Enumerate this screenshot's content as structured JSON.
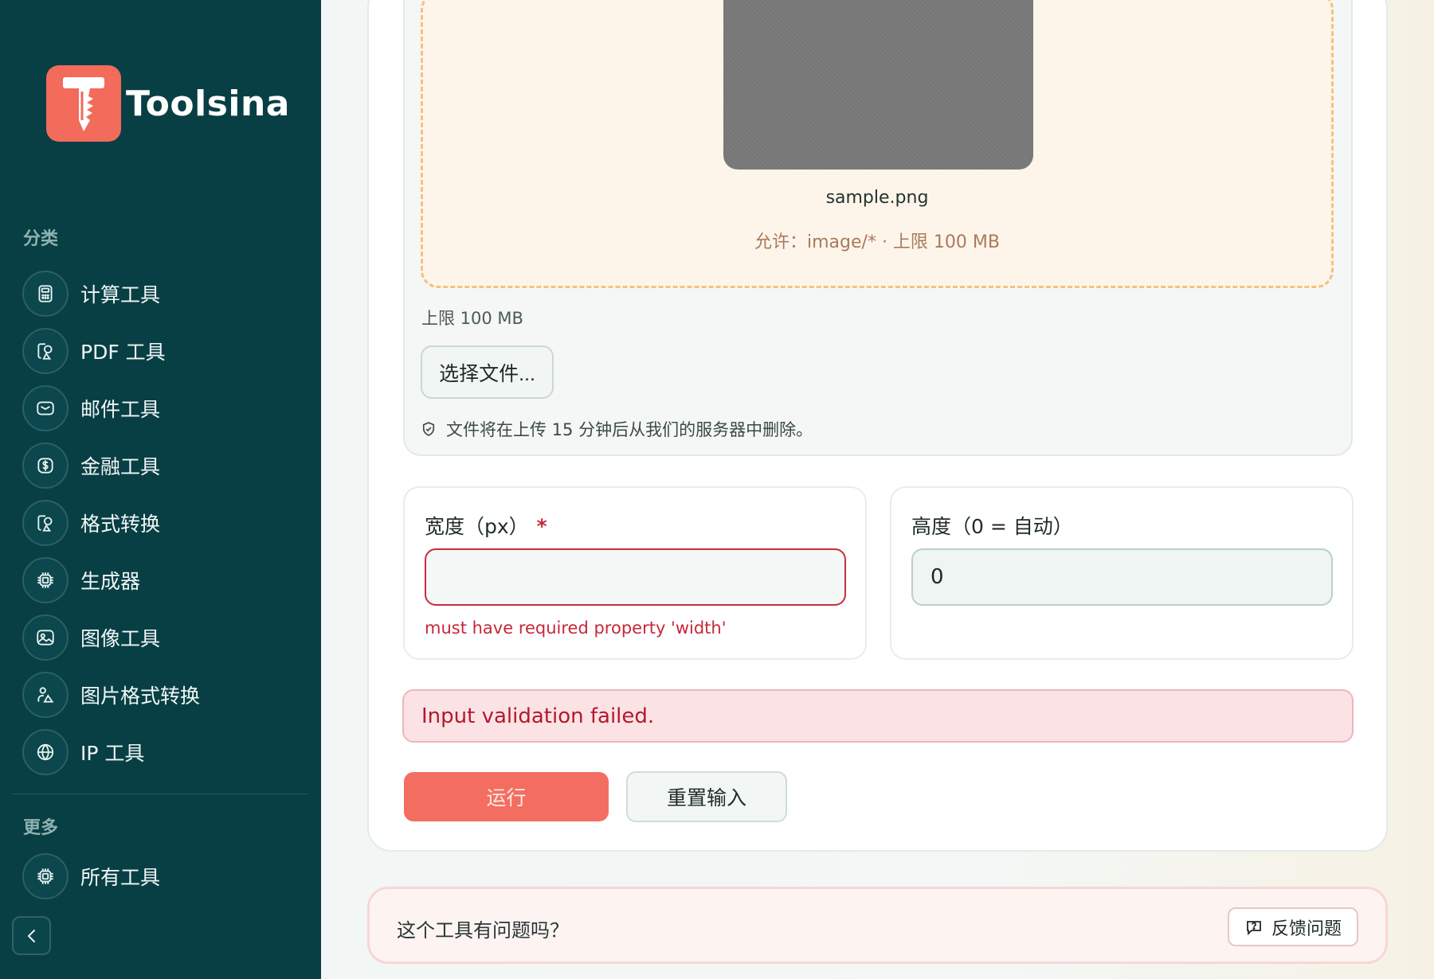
{
  "brand": {
    "name": "Toolsina",
    "logo_icon": "screw-logo-icon",
    "logo_color": "#f26b5b"
  },
  "sidebar": {
    "categories_label": "分类",
    "items": [
      {
        "label": "计算工具",
        "icon": "calculator-icon"
      },
      {
        "label": "PDF 工具",
        "icon": "document-shapes-icon"
      },
      {
        "label": "邮件工具",
        "icon": "mail-icon"
      },
      {
        "label": "金融工具",
        "icon": "dollar-icon"
      },
      {
        "label": "格式转换",
        "icon": "document-shapes-icon"
      },
      {
        "label": "生成器",
        "icon": "chip-icon"
      },
      {
        "label": "图像工具",
        "icon": "image-icon"
      },
      {
        "label": "图片格式转换",
        "icon": "shapes-icon"
      },
      {
        "label": "IP 工具",
        "icon": "globe-icon"
      }
    ],
    "more_label": "更多",
    "more_items": [
      {
        "label": "所有工具",
        "icon": "chip-icon"
      }
    ],
    "bg_color": "#083f45"
  },
  "upload": {
    "file_name": "sample.png",
    "allow_text": "允许：image/* · 上限 100 MB",
    "limit_text": "上限 100 MB",
    "choose_label": "选择文件...",
    "delete_note": "文件将在上传 15 分钟后从我们的服务器中删除。"
  },
  "fields": {
    "width": {
      "label": "宽度（px）",
      "required_mark": "*",
      "value": "",
      "error": "must have required property 'width'"
    },
    "height": {
      "label": "高度（0 = 自动）",
      "value": "0"
    }
  },
  "alert": {
    "text": "Input validation failed."
  },
  "actions": {
    "run_label": "运行",
    "reset_label": "重置输入",
    "run_color": "#f36e60"
  },
  "feedback": {
    "question": "这个工具有问题吗？",
    "button_label": "反馈问题"
  }
}
